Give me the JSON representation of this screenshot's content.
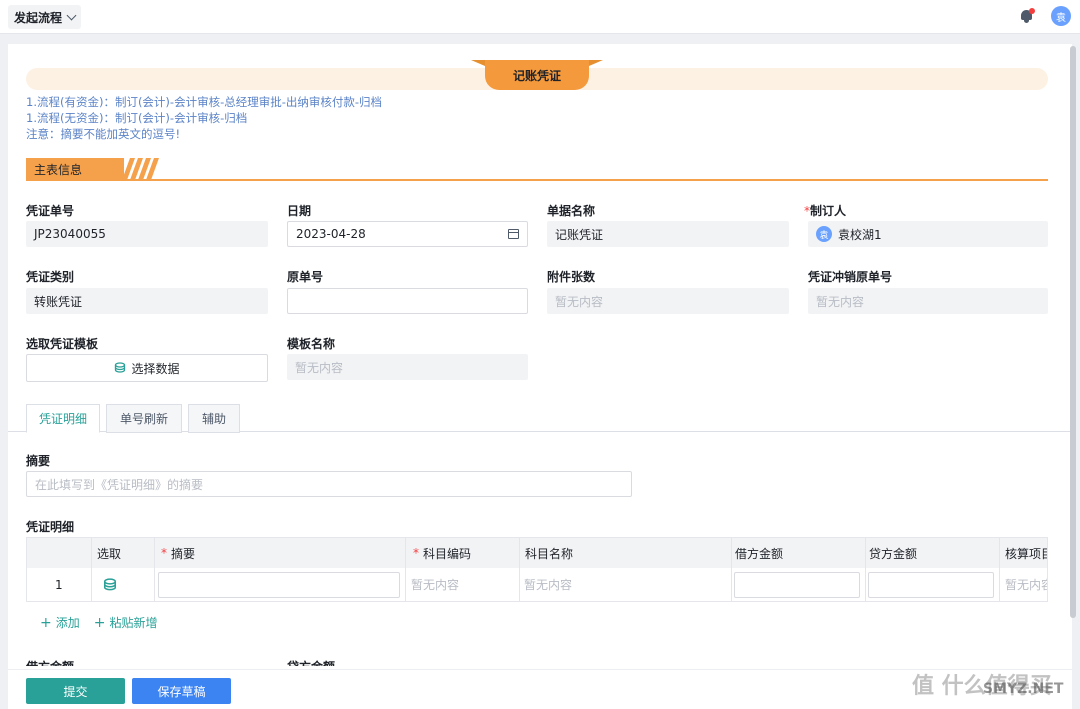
{
  "topbar": {
    "flow_label": "发起流程"
  },
  "user": {
    "avatar_text": "袁",
    "name": "袁校湖1"
  },
  "banner": {
    "title": "记账凭证"
  },
  "notes": [
    "1.流程(有资金)：制订(会计)-会计审核-总经理审批-出纳审核付款-归档",
    "1.流程(无资金)：制订(会计)-会计审核-归档",
    "注意：摘要不能加英文的逗号!"
  ],
  "section_title": "主表信息",
  "fields": {
    "voucher_no": {
      "label": "凭证单号",
      "value": "JP23040055"
    },
    "date": {
      "label": "日期",
      "value": "2023-04-28"
    },
    "doc_name": {
      "label": "单据名称",
      "value": "记账凭证"
    },
    "maker": {
      "label": "制订人",
      "required": "*"
    },
    "voucher_type": {
      "label": "凭证类别",
      "value": "转账凭证"
    },
    "orig_no": {
      "label": "原单号",
      "value": ""
    },
    "attach_count": {
      "label": "附件张数",
      "value": "暂无内容"
    },
    "reverse_no": {
      "label": "凭证冲销原单号",
      "value": "暂无内容"
    },
    "template": {
      "label": "选取凭证模板",
      "button": "选择数据"
    },
    "template_name": {
      "label": "模板名称",
      "value": "暂无内容"
    }
  },
  "tabs": [
    "凭证明细",
    "单号刷新",
    "辅助"
  ],
  "summary": {
    "label": "摘要",
    "placeholder": "在此填写到《凭证明细》的摘要"
  },
  "detail": {
    "title": "凭证明细",
    "columns": [
      "选取",
      "摘要",
      "科目编码",
      "科目名称",
      "借方金额",
      "贷方金额",
      "核算项目"
    ],
    "required_mark": "*",
    "row": {
      "index": "1",
      "code": "暂无内容",
      "name": "暂无内容",
      "aux": "暂无内容"
    }
  },
  "actions": {
    "add": "添加",
    "paste_add": "粘贴新增"
  },
  "cut_labels": {
    "debit": "借方金额",
    "credit": "贷方金额"
  },
  "footer": {
    "submit": "提交",
    "save_draft": "保存草稿"
  },
  "watermark": {
    "main": "值 什么值得买",
    "sub": "SMYZ.NET"
  }
}
